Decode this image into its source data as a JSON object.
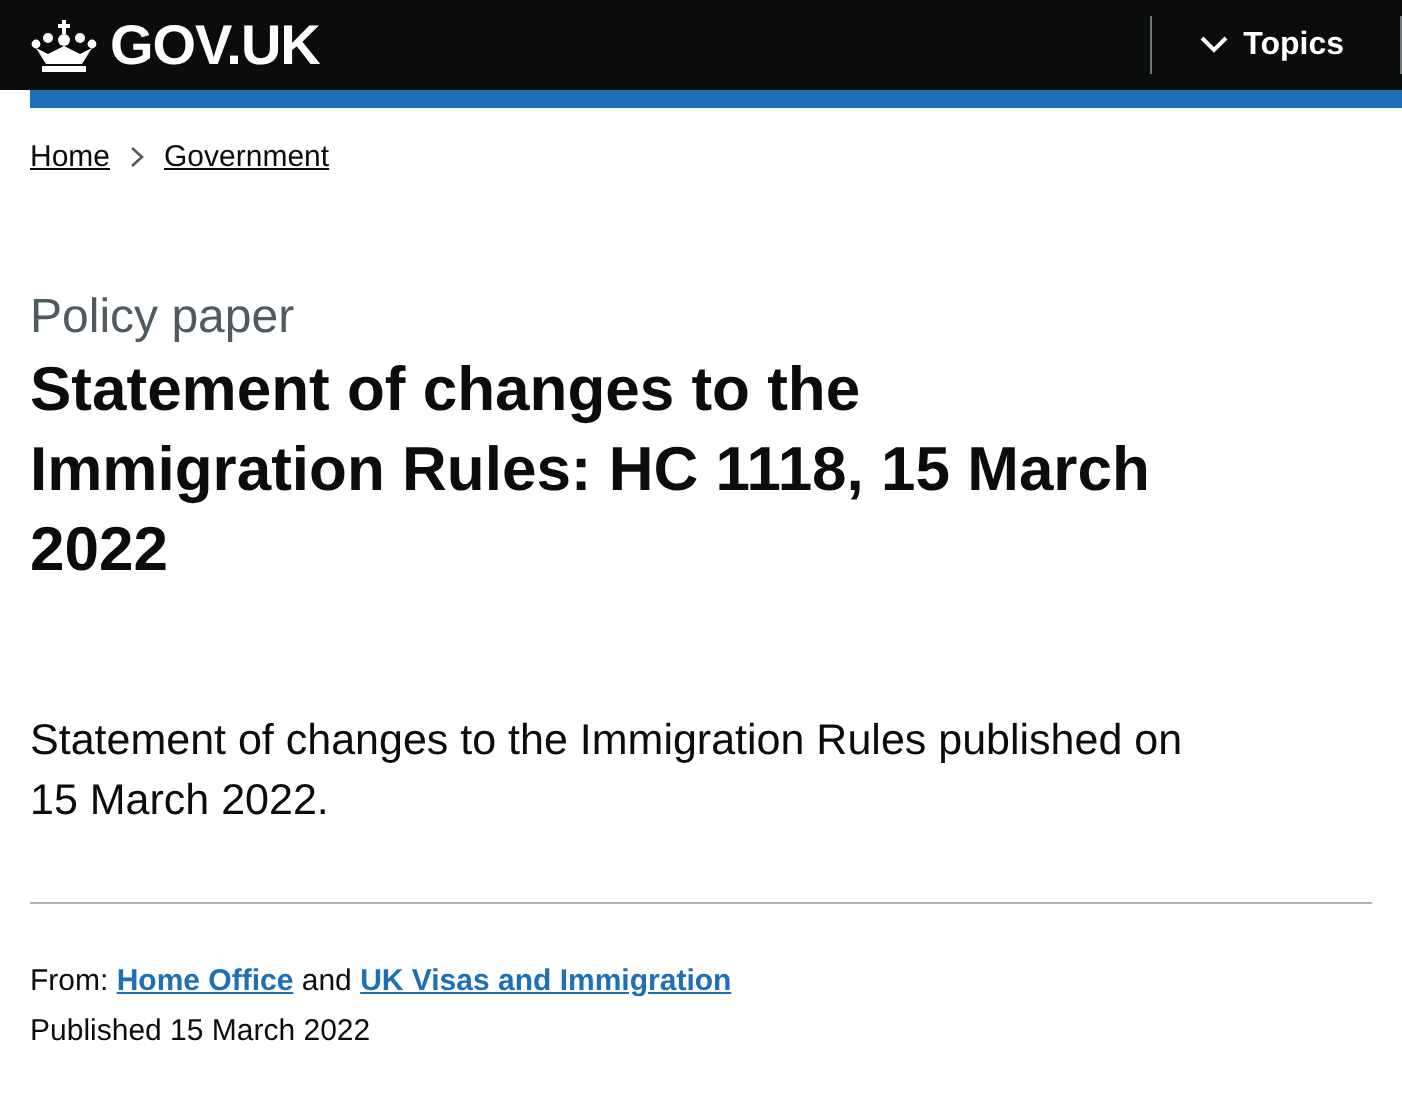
{
  "header": {
    "logo": "GOV.UK",
    "menu_button": "Topics"
  },
  "breadcrumbs": [
    "Home",
    "Government"
  ],
  "document_type": "Policy paper",
  "title": "Statement of changes to the Immigration Rules: HC 1118, 15 March 2022",
  "summary": "Statement of changes to the Immigration Rules published on 15 March 2022.",
  "metadata": {
    "from_label": "From:",
    "organisations": [
      "Home Office",
      "UK Visas and Immigration"
    ],
    "joiner": "and",
    "published": "Published 15 March 2022"
  }
}
